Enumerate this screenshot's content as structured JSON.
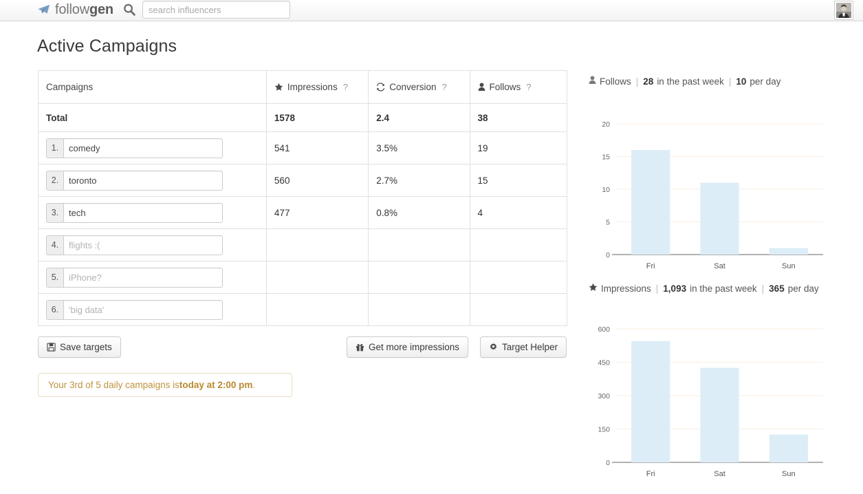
{
  "navbar": {
    "brand_light": "follow",
    "brand_bold": "gen",
    "plane_icon": "paper-plane-icon",
    "search_icon": "search-icon",
    "search_placeholder": "search influencers",
    "search_value": "",
    "avatar_icon": "user-avatar-photo"
  },
  "page": {
    "title": "Active Campaigns"
  },
  "table": {
    "columns": [
      {
        "label": "Campaigns",
        "icon": null,
        "help": ""
      },
      {
        "label": "Impressions",
        "icon": "star-icon",
        "help": "?"
      },
      {
        "label": "Conversion",
        "icon": "refresh-icon",
        "help": "?"
      },
      {
        "label": "Follows",
        "icon": "user-icon",
        "help": "?"
      }
    ],
    "total_row": {
      "label": "Total",
      "impressions": "1578",
      "conversion": "2.4",
      "follows": "38"
    },
    "rows": [
      {
        "index": "1.",
        "value": "comedy",
        "placeholder": "",
        "impressions": "541",
        "conversion": "3.5%",
        "follows": "19"
      },
      {
        "index": "2.",
        "value": "toronto",
        "placeholder": "",
        "impressions": "560",
        "conversion": "2.7%",
        "follows": "15"
      },
      {
        "index": "3.",
        "value": "tech",
        "placeholder": "",
        "impressions": "477",
        "conversion": "0.8%",
        "follows": "4"
      },
      {
        "index": "4.",
        "value": "",
        "placeholder": "flights :(",
        "impressions": "",
        "conversion": "",
        "follows": ""
      },
      {
        "index": "5.",
        "value": "",
        "placeholder": "iPhone?",
        "impressions": "",
        "conversion": "",
        "follows": ""
      },
      {
        "index": "6.",
        "value": "",
        "placeholder": "'big data'",
        "impressions": "",
        "conversion": "",
        "follows": ""
      }
    ]
  },
  "buttons": {
    "save": {
      "label": "Save targets",
      "icon": "floppy-disk-icon"
    },
    "impressions": {
      "label": "Get more impressions",
      "icon": "gift-icon"
    },
    "helper": {
      "label": "Target Helper",
      "icon": "gear-icon"
    }
  },
  "alert": {
    "text_before": "Your 3rd of 5 daily campaigns is ",
    "text_bold": "today at 2:00 pm",
    "text_after": ".",
    "border_color": "#e7ddbf",
    "text_color": "#c0923f"
  },
  "follows_caption": {
    "icon": "user-icon",
    "label": "Follows",
    "week_value": "28",
    "week_text": "in the past week",
    "per_day_value": "10",
    "per_day_text": "per day"
  },
  "impressions_caption": {
    "icon": "star-icon",
    "label": "Impressions",
    "week_value": "1,093",
    "week_text": "in the past week",
    "per_day_value": "365",
    "per_day_text": "per day"
  },
  "colors": {
    "bar_fill": "#dcedf7",
    "gridline": "#fbf3e8",
    "axis_line": "#999999",
    "alert_gold": "#c0923f"
  },
  "chart_data": [
    {
      "id": "follows",
      "type": "bar",
      "title": "Follows",
      "categories": [
        "Fri",
        "Sat",
        "Sun"
      ],
      "values": [
        16,
        11,
        1
      ],
      "yticks": [
        0,
        5,
        10,
        15,
        20
      ],
      "ylim": [
        0,
        20
      ],
      "xlabel": "",
      "ylabel": "",
      "grid": true,
      "legend": "none",
      "bar_color": "#dcedf7"
    },
    {
      "id": "impressions",
      "type": "bar",
      "title": "Impressions",
      "categories": [
        "Fri",
        "Sat",
        "Sun"
      ],
      "values": [
        545,
        425,
        125
      ],
      "yticks": [
        0,
        150,
        300,
        450,
        600
      ],
      "ylim": [
        0,
        600
      ],
      "xlabel": "",
      "ylabel": "",
      "grid": true,
      "legend": "none",
      "bar_color": "#dcedf7"
    }
  ]
}
